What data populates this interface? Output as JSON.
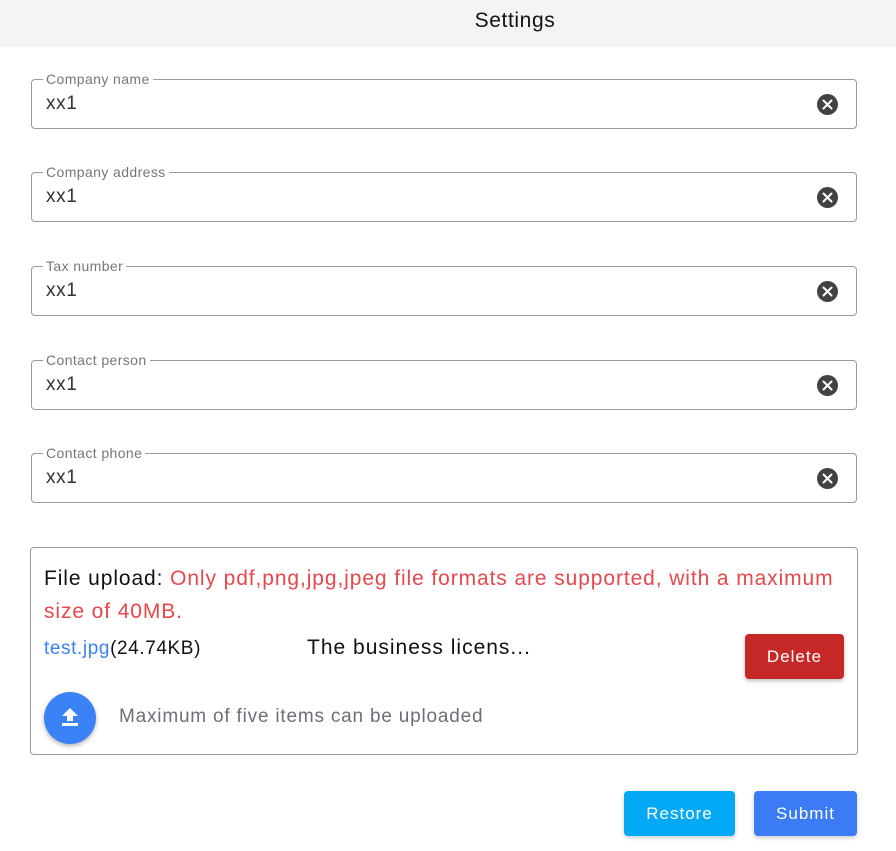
{
  "header": {
    "title": "Settings"
  },
  "fields": [
    {
      "label": "Company name",
      "value": "xx1"
    },
    {
      "label": "Company address",
      "value": "xx1"
    },
    {
      "label": "Tax number",
      "value": "xx1"
    },
    {
      "label": "Contact person",
      "value": "xx1"
    },
    {
      "label": "Contact phone",
      "value": "xx1"
    }
  ],
  "upload": {
    "label": "File upload: ",
    "note": "Only pdf,png,jpg,jpeg file formats are supported, with a maximum size of 40MB.",
    "file": {
      "name": "test.jpg",
      "size": "(24.74KB)",
      "description": "The business licens..."
    },
    "delete_label": "Delete",
    "hint": "Maximum of five items can be uploaded"
  },
  "actions": {
    "restore_label": "Restore",
    "submit_label": "Submit"
  },
  "colors": {
    "header_bg": "#f3f4f6",
    "note": "#e5484d",
    "link": "#3b82f6",
    "delete": "#c62828",
    "restore": "#03a9f4",
    "submit": "#3b7cf6"
  },
  "icons": {
    "clear": "close-circle-icon",
    "upload": "upload-icon"
  }
}
